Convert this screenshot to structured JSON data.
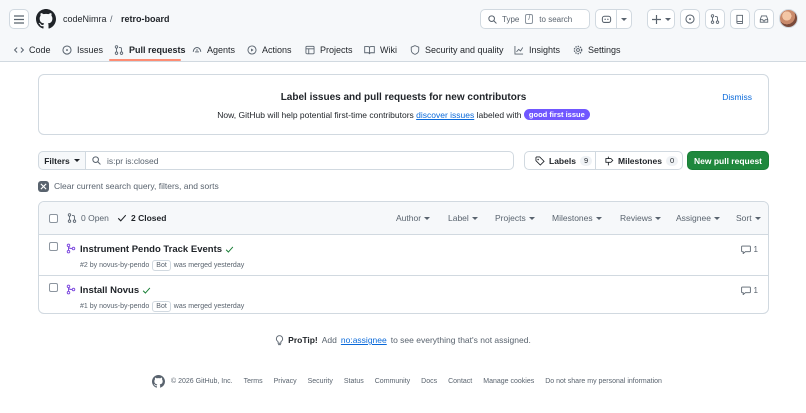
{
  "header": {
    "owner": "codeNimra",
    "separator": "/",
    "repo": "retro-board",
    "search_prefix": "Type",
    "search_key": "/",
    "search_suffix": "to search"
  },
  "tabs": [
    {
      "label": "Code"
    },
    {
      "label": "Issues"
    },
    {
      "label": "Pull requests"
    },
    {
      "label": "Agents"
    },
    {
      "label": "Actions"
    },
    {
      "label": "Projects"
    },
    {
      "label": "Wiki"
    },
    {
      "label": "Security and quality"
    },
    {
      "label": "Insights"
    },
    {
      "label": "Settings"
    }
  ],
  "banner": {
    "title": "Label issues and pull requests for new contributors",
    "text_before": "Now, GitHub will help potential first-time contributors",
    "link": "discover issues",
    "text_after": "labeled with",
    "label": "good first issue",
    "dismiss": "Dismiss"
  },
  "filterbar": {
    "filters_label": "Filters",
    "query": "is:pr is:closed",
    "labels_label": "Labels",
    "labels_count": "9",
    "milestones_label": "Milestones",
    "milestones_count": "0",
    "new_pr": "New pull request",
    "clear_text": "Clear current search query, filters, and sorts"
  },
  "list": {
    "open_label": "0 Open",
    "closed_label": "2 Closed",
    "sort_menus": [
      "Author",
      "Label",
      "Projects",
      "Milestones",
      "Reviews",
      "Assignee",
      "Sort"
    ],
    "items": [
      {
        "title": "Instrument Pendo Track Events",
        "meta": "#2 by novus-by-pendo",
        "badge": "Bot",
        "status": "was merged yesterday",
        "comments": "1"
      },
      {
        "title": "Install Novus",
        "meta": "#1 by novus-by-pendo",
        "badge": "Bot",
        "status": "was merged yesterday",
        "comments": "1"
      }
    ]
  },
  "protip": {
    "lead": "ProTip!",
    "before": "Add",
    "link": "no:assignee",
    "after": "to see everything that's not assigned."
  },
  "footer": {
    "copyright": "© 2026 GitHub, Inc.",
    "links": [
      "Terms",
      "Privacy",
      "Security",
      "Status",
      "Community",
      "Docs",
      "Contact",
      "Manage cookies",
      "Do not share my personal information"
    ]
  },
  "colors": {
    "accent_green": "#1f883d",
    "link_blue": "#0969da",
    "merged_purple": "#8250df",
    "tab_underline": "#fd8c73",
    "gfi_label": "#7057ff"
  }
}
